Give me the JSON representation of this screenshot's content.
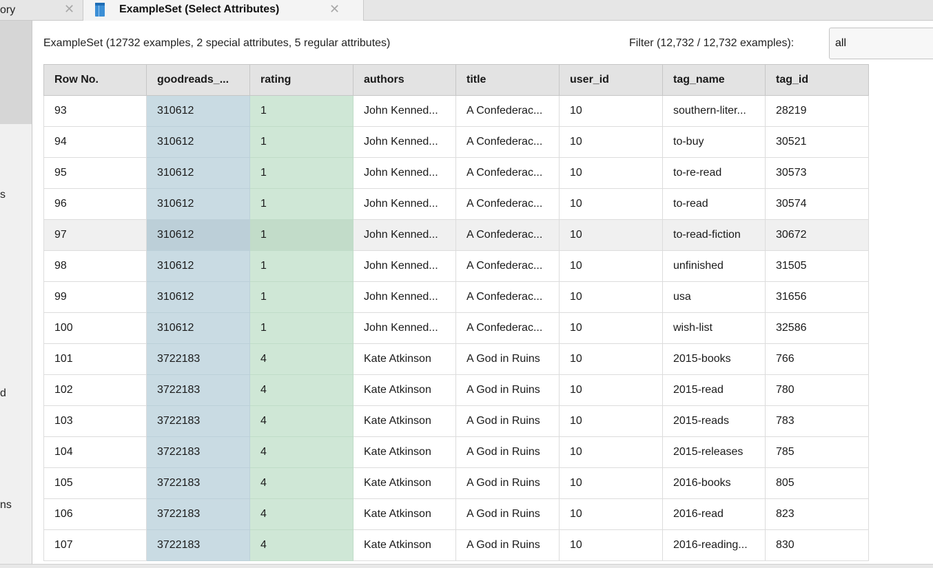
{
  "tabs": {
    "previous_label": "ory",
    "active_label": "ExampleSet (Select Attributes)",
    "close_glyph": "✕"
  },
  "left_strip": {
    "fragments": [
      "s",
      "d",
      "ns"
    ]
  },
  "info_text": "ExampleSet (12732 examples, 2 special attributes, 5 regular attributes)",
  "filter": {
    "label": "Filter (12,732 / 12,732 examples):",
    "value": "all"
  },
  "colors": {
    "special_id_bg": "#c9dbe3",
    "special_label_bg": "#cfe7d6",
    "header_bg": "#e3e3e3",
    "tab_icon": "#3c8fd6"
  },
  "icons": {
    "tab_icon": "table-icon",
    "close": "close-icon"
  },
  "table": {
    "columns": [
      "Row No.",
      "goodreads_...",
      "rating",
      "authors",
      "title",
      "user_id",
      "tag_name",
      "tag_id"
    ],
    "rows": [
      [
        "93",
        "310612",
        "1",
        "John Kenned...",
        "A Confederac...",
        "10",
        "southern-liter...",
        "28219"
      ],
      [
        "94",
        "310612",
        "1",
        "John Kenned...",
        "A Confederac...",
        "10",
        "to-buy",
        "30521"
      ],
      [
        "95",
        "310612",
        "1",
        "John Kenned...",
        "A Confederac...",
        "10",
        "to-re-read",
        "30573"
      ],
      [
        "96",
        "310612",
        "1",
        "John Kenned...",
        "A Confederac...",
        "10",
        "to-read",
        "30574"
      ],
      [
        "97",
        "310612",
        "1",
        "John Kenned...",
        "A Confederac...",
        "10",
        "to-read-fiction",
        "30672"
      ],
      [
        "98",
        "310612",
        "1",
        "John Kenned...",
        "A Confederac...",
        "10",
        "unfinished",
        "31505"
      ],
      [
        "99",
        "310612",
        "1",
        "John Kenned...",
        "A Confederac...",
        "10",
        "usa",
        "31656"
      ],
      [
        "100",
        "310612",
        "1",
        "John Kenned...",
        "A Confederac...",
        "10",
        "wish-list",
        "32586"
      ],
      [
        "101",
        "3722183",
        "4",
        "Kate Atkinson",
        "A God in Ruins",
        "10",
        "2015-books",
        "766"
      ],
      [
        "102",
        "3722183",
        "4",
        "Kate Atkinson",
        "A God in Ruins",
        "10",
        "2015-read",
        "780"
      ],
      [
        "103",
        "3722183",
        "4",
        "Kate Atkinson",
        "A God in Ruins",
        "10",
        "2015-reads",
        "783"
      ],
      [
        "104",
        "3722183",
        "4",
        "Kate Atkinson",
        "A God in Ruins",
        "10",
        "2015-releases",
        "785"
      ],
      [
        "105",
        "3722183",
        "4",
        "Kate Atkinson",
        "A God in Ruins",
        "10",
        "2016-books",
        "805"
      ],
      [
        "106",
        "3722183",
        "4",
        "Kate Atkinson",
        "A God in Ruins",
        "10",
        "2016-read",
        "823"
      ],
      [
        "107",
        "3722183",
        "4",
        "Kate Atkinson",
        "A God in Ruins",
        "10",
        "2016-reading...",
        "830"
      ]
    ],
    "hovered_row": 4
  }
}
